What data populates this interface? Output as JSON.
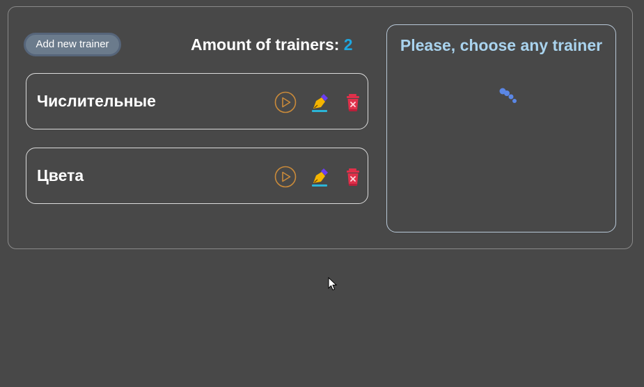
{
  "toolbar": {
    "add_label": "Add new trainer",
    "amount_label": "Amount of trainers:",
    "amount_count": "2"
  },
  "trainers": [
    {
      "name": "Числительные",
      "actions": [
        "play-icon",
        "edit-icon",
        "delete-icon"
      ]
    },
    {
      "name": "Цвета",
      "actions": [
        "play-icon",
        "edit-icon",
        "delete-icon"
      ]
    }
  ],
  "side_panel": {
    "title": "Please, choose any trainer",
    "indicator": "loading-spinner-icon"
  },
  "colors": {
    "background": "#484848",
    "accent": "#1ea7e0",
    "panel_title": "#a9d3ee",
    "play": "#c98a3a",
    "delete": "#e0304a",
    "spinner": "#5b87e6"
  }
}
